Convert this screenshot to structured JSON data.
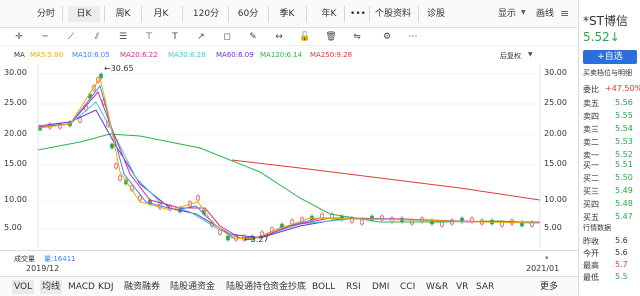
{
  "tabs": [
    "分时",
    "日K",
    "周K",
    "月K",
    "120分",
    "60分",
    "季K",
    "年K",
    "•••",
    "个股资料",
    "诊股"
  ],
  "display_btn": "显示",
  "draw_btn": "画线",
  "ma": {
    "label": "MA",
    "ma5": "MA5:5.80",
    "ma10": "MA10:6.05",
    "ma20": "MA20:6.22",
    "ma30": "MA30:6.28",
    "ma60": "MA60:6.09",
    "ma120": "MA120:6.14",
    "ma250": "MA250:9.28",
    "rehab": "后复权"
  },
  "y_left": [
    "30.00",
    "25.00",
    "20.00",
    "15.00",
    "10.00",
    "5.00"
  ],
  "y_right": [
    "30.00",
    "25.00",
    "20.00",
    "15.00",
    "10.00",
    "5.00"
  ],
  "annot": {
    "high": "30.65",
    "low": "3.27"
  },
  "vol": {
    "label": "成交量",
    "value": "量:16411"
  },
  "dates": {
    "start": "2019/12",
    "end": "2021/01"
  },
  "ind": [
    "VOL",
    "均线",
    "MACD",
    "KDJ",
    "融资融券",
    "陆股通资金",
    "陆股通持仓",
    "资金抄底",
    "BOLL",
    "RSI",
    "DMI",
    "CCI",
    "W&R",
    "VR",
    "SAR",
    "更多"
  ],
  "stock": {
    "name": "*ST博信",
    "price": "5.52",
    "arrow": "↓",
    "add": "+自选",
    "depth_title": "买卖档位与明细",
    "wb_label": "委比",
    "wb": "+47.50%"
  },
  "sells": [
    {
      "l": "卖五",
      "p": "5.56"
    },
    {
      "l": "卖四",
      "p": "5.55"
    },
    {
      "l": "卖三",
      "p": "5.54"
    },
    {
      "l": "卖二",
      "p": "5.53"
    },
    {
      "l": "卖一",
      "p": "5.52"
    }
  ],
  "buys": [
    {
      "l": "买一",
      "p": "5.51"
    },
    {
      "l": "买二",
      "p": "5.50"
    },
    {
      "l": "买三",
      "p": "5.49"
    },
    {
      "l": "买四",
      "p": "5.48"
    },
    {
      "l": "买五",
      "p": "5.47"
    }
  ],
  "quote": {
    "title": "行情数据",
    "rows": [
      {
        "l": "昨收",
        "v": "5.6"
      },
      {
        "l": "今开",
        "v": "5.6"
      },
      {
        "l": "最高",
        "v": "5.7"
      },
      {
        "l": "最低",
        "v": "5.5"
      }
    ]
  },
  "colors": {
    "ma5": "#f2a900",
    "ma10": "#3b82f6",
    "ma20": "#e0279b",
    "ma30": "#3fc8d6",
    "ma60": "#6b2fd9",
    "ma120": "#2db34a",
    "ma250": "#e03a3a",
    "up": "#e03a3a",
    "down": "#2aa54a"
  }
}
